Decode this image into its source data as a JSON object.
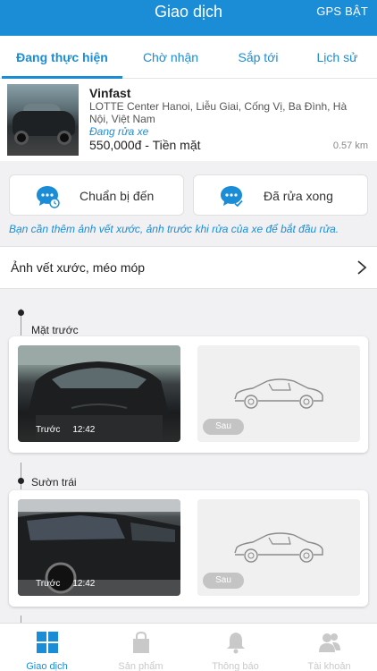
{
  "header": {
    "title": "Giao dịch",
    "gps": "GPS BẬT"
  },
  "tabs": [
    {
      "label": "Đang thực hiện",
      "active": true
    },
    {
      "label": "Chờ nhận"
    },
    {
      "label": "Sắp tới"
    },
    {
      "label": "Lịch sử"
    }
  ],
  "order": {
    "car_name": "Vinfast",
    "address": "LOTTE Center Hanoi, Liễu Giai, Cống Vị, Ba Đình, Hà Nội, Việt Nam",
    "status": "Đang rửa xe",
    "price": "550,000đ - Tiền mặt",
    "distance": "0.57 km"
  },
  "actions": {
    "prepare": "Chuẩn bị đến",
    "done": "Đã rửa xong"
  },
  "notice": "Bạn cần thêm ảnh vết xước, ảnh trước khi rửa của xe để bắt đầu rửa.",
  "section": {
    "label": "Ảnh vết xước, méo móp"
  },
  "photo_groups": [
    {
      "label": "Mặt trước",
      "before_caption": "Trước",
      "before_time": "12:42",
      "after_caption": "Sau"
    },
    {
      "label": "Sườn trái",
      "before_caption": "Trước",
      "before_time": "12:42",
      "after_caption": "Sau"
    }
  ],
  "bottom_nav": [
    {
      "label": "Giao dịch",
      "icon": "grid-icon",
      "active": true
    },
    {
      "label": "Sản phẩm",
      "icon": "bag-icon"
    },
    {
      "label": "Thông báo",
      "icon": "bell-icon"
    },
    {
      "label": "Tài khoản",
      "icon": "users-icon"
    }
  ],
  "colors": {
    "primary": "#1b8dd6",
    "inactive": "#c9c9c9"
  }
}
